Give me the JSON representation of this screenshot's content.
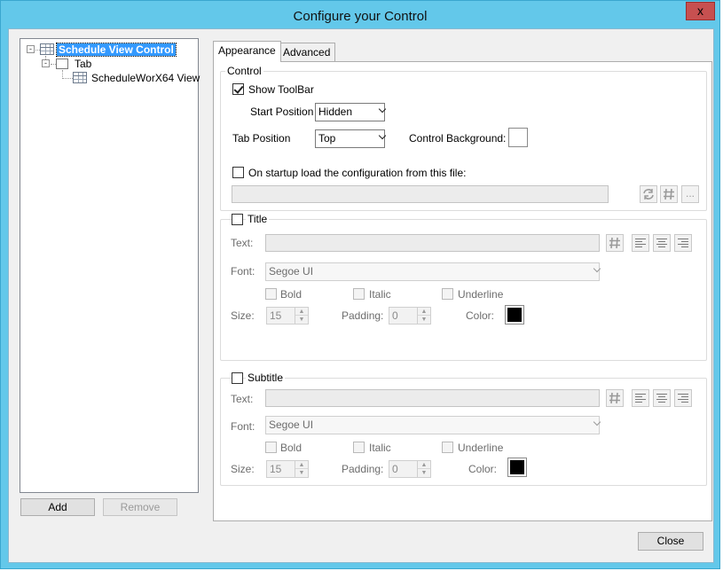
{
  "window": {
    "title": "Configure your Control",
    "close_glyph": "x"
  },
  "tree": {
    "root": {
      "label": "Schedule View Control",
      "icon": "grid-icon",
      "expander": "-"
    },
    "tab": {
      "label": "Tab",
      "icon": "tab-icon",
      "expander": "-"
    },
    "view": {
      "label": "ScheduleWorX64 View",
      "icon": "grid-icon"
    }
  },
  "left_buttons": {
    "add": "Add",
    "remove": "Remove"
  },
  "tabs": {
    "appearance": "Appearance",
    "advanced": "Advanced"
  },
  "control_group": {
    "title": "Control",
    "show_toolbar": {
      "label": "Show ToolBar",
      "checked": true
    },
    "start_position": {
      "label": "Start Position",
      "value": "Hidden"
    },
    "tab_position": {
      "label": "Tab Position",
      "value": "Top"
    },
    "background": {
      "label": "Control Background:",
      "color": "#ffffff"
    },
    "startup_load": {
      "label": "On startup load the configuration from this file:",
      "checked": false,
      "path": ""
    },
    "browse_glyph": "..."
  },
  "title_group": {
    "label": "Title",
    "checked": false,
    "text_label": "Text:",
    "text_value": "",
    "font_label": "Font:",
    "font_value": "Segoe UI",
    "bold": "Bold",
    "italic": "Italic",
    "underline": "Underline",
    "size_label": "Size:",
    "size_value": "15",
    "padding_label": "Padding:",
    "padding_value": "0",
    "color_label": "Color:",
    "color": "#000000"
  },
  "subtitle_group": {
    "label": "Subtitle",
    "checked": false,
    "text_label": "Text:",
    "text_value": "",
    "font_label": "Font:",
    "font_value": "Segoe UI",
    "bold": "Bold",
    "italic": "Italic",
    "underline": "Underline",
    "size_label": "Size:",
    "size_value": "15",
    "padding_label": "Padding:",
    "padding_value": "0",
    "color_label": "Color:",
    "color": "#000000"
  },
  "footer": {
    "close": "Close"
  }
}
